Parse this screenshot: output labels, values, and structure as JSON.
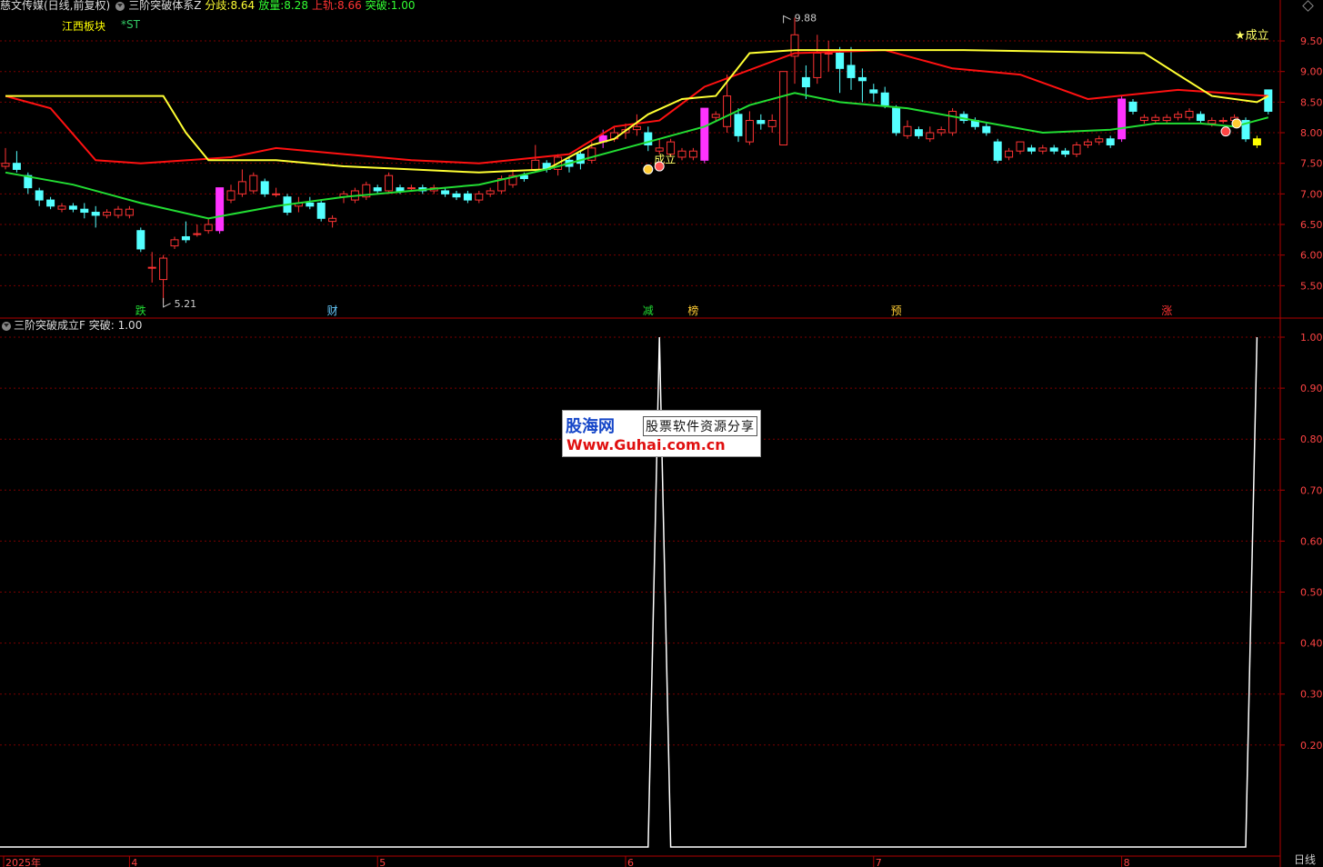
{
  "header": {
    "stock_title": "慈文传媒(日线,前复权)",
    "indicator_name": "三阶突破体系Z",
    "items": [
      {
        "label": "分歧:",
        "value": "8.64",
        "color": "#ffff33"
      },
      {
        "label": "放量:",
        "value": "8.28",
        "color": "#33ff33"
      },
      {
        "label": "上轨:",
        "value": "8.66",
        "color": "#ff3333"
      },
      {
        "label": "突破:",
        "value": "1.00",
        "color": "#33ff33"
      }
    ]
  },
  "sector": "江西板块",
  "st_flag": "*ST",
  "sub_header": {
    "title": "三阶突破成立F",
    "label": "突破:",
    "value": "1.00"
  },
  "period": "日线",
  "watermark": {
    "logo": "股海网",
    "tagline": "股票软件资源分享",
    "url": "Www.Guhai.com.cn"
  },
  "colors": {
    "up": "#ff3333",
    "down": "#54ffff",
    "signal_bar": "#ff33ff",
    "yellow_bar": "#ffff00",
    "upper_line": "#ff1111",
    "yellow_line": "#ffff33",
    "green_line": "#22dd33",
    "grid": "#7a0000",
    "axis": "#b00000",
    "sub_line": "#ffffff"
  },
  "chart_data": [
    {
      "type": "candlestick",
      "title": "三阶突破体系Z",
      "ylim": [
        5.0,
        10.05
      ],
      "y_ticks": [
        "9.50",
        "9.00",
        "8.50",
        "8.00",
        "7.50",
        "7.00",
        "6.50",
        "6.00",
        "5.50"
      ],
      "annotations": {
        "high": "9.88",
        "low": "5.21",
        "signal_label": "成立",
        "star_label": "★成立"
      },
      "bottom_marks": [
        {
          "i": 12,
          "text": "跌",
          "color": "#22dd33"
        },
        {
          "i": 29,
          "text": "财",
          "color": "#66ccff"
        },
        {
          "i": 57,
          "text": "减",
          "color": "#22dd33"
        },
        {
          "i": 61,
          "text": "榜",
          "color": "#ffcc33"
        },
        {
          "i": 79,
          "text": "预",
          "color": "#ffcc33"
        },
        {
          "i": 103,
          "text": "涨",
          "color": "#ff3333"
        }
      ],
      "candles": [
        [
          7.45,
          7.5,
          7.75,
          7.4
        ],
        [
          7.5,
          7.4,
          7.7,
          7.35
        ],
        [
          7.3,
          7.1,
          7.35,
          7.0
        ],
        [
          7.05,
          6.9,
          7.1,
          6.8
        ],
        [
          6.9,
          6.8,
          6.95,
          6.75
        ],
        [
          6.75,
          6.8,
          6.85,
          6.7
        ],
        [
          6.8,
          6.75,
          6.85,
          6.7
        ],
        [
          6.75,
          6.7,
          6.85,
          6.6
        ],
        [
          6.7,
          6.65,
          6.8,
          6.45
        ],
        [
          6.65,
          6.7,
          6.75,
          6.6
        ],
        [
          6.65,
          6.75,
          6.8,
          6.6
        ],
        [
          6.65,
          6.75,
          6.8,
          6.6
        ],
        [
          6.4,
          6.1,
          6.45,
          6.05
        ],
        [
          5.8,
          5.8,
          6.05,
          5.55
        ],
        [
          5.6,
          5.95,
          6.0,
          5.21
        ],
        [
          6.15,
          6.25,
          6.3,
          6.1
        ],
        [
          6.3,
          6.25,
          6.55,
          6.2
        ],
        [
          6.35,
          6.35,
          6.5,
          6.3
        ],
        [
          6.4,
          6.5,
          6.6,
          6.35
        ],
        [
          6.4,
          7.1,
          7.1,
          6.35
        ],
        [
          6.9,
          7.05,
          7.15,
          6.85
        ],
        [
          7.0,
          7.2,
          7.4,
          6.95
        ],
        [
          7.05,
          7.3,
          7.35,
          7.0
        ],
        [
          7.2,
          7.0,
          7.25,
          6.95
        ],
        [
          7.0,
          7.0,
          7.1,
          6.95
        ],
        [
          6.95,
          6.7,
          7.0,
          6.65
        ],
        [
          6.8,
          6.85,
          6.95,
          6.7
        ],
        [
          6.85,
          6.8,
          6.95,
          6.75
        ],
        [
          6.85,
          6.6,
          6.9,
          6.55
        ],
        [
          6.55,
          6.6,
          6.65,
          6.45
        ],
        [
          6.95,
          7.0,
          7.05,
          6.85
        ],
        [
          6.9,
          7.05,
          7.1,
          6.85
        ],
        [
          6.95,
          7.15,
          7.2,
          6.9
        ],
        [
          7.1,
          7.05,
          7.15,
          7.0
        ],
        [
          7.05,
          7.3,
          7.35,
          7.0
        ],
        [
          7.1,
          7.05,
          7.15,
          7.0
        ],
        [
          7.1,
          7.1,
          7.15,
          7.05
        ],
        [
          7.1,
          7.05,
          7.15,
          7.0
        ],
        [
          7.05,
          7.1,
          7.15,
          7.0
        ],
        [
          7.05,
          7.0,
          7.1,
          6.95
        ],
        [
          7.0,
          6.95,
          7.05,
          6.9
        ],
        [
          7.0,
          6.9,
          7.05,
          6.85
        ],
        [
          6.9,
          7.0,
          7.05,
          6.85
        ],
        [
          7.0,
          7.05,
          7.1,
          6.95
        ],
        [
          7.05,
          7.25,
          7.3,
          7.0
        ],
        [
          7.15,
          7.3,
          7.4,
          7.1
        ],
        [
          7.3,
          7.25,
          7.35,
          7.2
        ],
        [
          7.4,
          7.55,
          7.8,
          7.35
        ],
        [
          7.5,
          7.4,
          7.55,
          7.35
        ],
        [
          7.4,
          7.6,
          7.65,
          7.3
        ],
        [
          7.55,
          7.45,
          7.6,
          7.35
        ],
        [
          7.65,
          7.5,
          7.7,
          7.4
        ],
        [
          7.55,
          7.75,
          7.85,
          7.5
        ],
        [
          7.85,
          7.95,
          8.05,
          7.75
        ],
        [
          7.9,
          8.0,
          8.1,
          7.85
        ],
        [
          8.0,
          8.05,
          8.15,
          7.9
        ],
        [
          8.05,
          8.1,
          8.3,
          7.95
        ],
        [
          8.0,
          7.8,
          8.1,
          7.7
        ],
        [
          7.7,
          7.75,
          7.9,
          7.65
        ],
        [
          7.65,
          7.85,
          7.9,
          7.6
        ],
        [
          7.6,
          7.7,
          7.75,
          7.55
        ],
        [
          7.6,
          7.7,
          7.75,
          7.55
        ],
        [
          7.55,
          8.4,
          8.4,
          7.5
        ],
        [
          8.25,
          8.3,
          8.35,
          8.2
        ],
        [
          8.1,
          8.6,
          8.95,
          8.0
        ],
        [
          8.3,
          7.95,
          8.4,
          7.85
        ],
        [
          7.85,
          8.2,
          8.35,
          7.8
        ],
        [
          8.2,
          8.15,
          8.3,
          8.05
        ],
        [
          8.1,
          8.2,
          8.3,
          8.0
        ],
        [
          7.8,
          9.0,
          9.0,
          7.8
        ],
        [
          9.25,
          9.6,
          9.88,
          8.8
        ],
        [
          8.9,
          8.75,
          9.1,
          8.55
        ],
        [
          8.9,
          9.3,
          9.6,
          8.8
        ],
        [
          9.3,
          9.3,
          9.5,
          9.0
        ],
        [
          9.3,
          9.05,
          9.4,
          8.65
        ],
        [
          9.1,
          8.9,
          9.4,
          8.7
        ],
        [
          8.9,
          8.85,
          9.05,
          8.5
        ],
        [
          8.7,
          8.65,
          8.8,
          8.5
        ],
        [
          8.65,
          8.45,
          8.75,
          8.4
        ],
        [
          8.4,
          8.0,
          8.45,
          7.95
        ],
        [
          7.95,
          8.1,
          8.2,
          7.9
        ],
        [
          8.05,
          7.95,
          8.1,
          7.9
        ],
        [
          7.9,
          8.0,
          8.1,
          7.85
        ],
        [
          8.0,
          8.05,
          8.1,
          7.95
        ],
        [
          8.0,
          8.35,
          8.4,
          7.95
        ],
        [
          8.3,
          8.2,
          8.35,
          8.15
        ],
        [
          8.2,
          8.1,
          8.25,
          8.05
        ],
        [
          8.1,
          8.0,
          8.15,
          7.95
        ],
        [
          7.85,
          7.55,
          7.9,
          7.5
        ],
        [
          7.6,
          7.7,
          7.75,
          7.55
        ],
        [
          7.7,
          7.85,
          7.85,
          7.65
        ],
        [
          7.75,
          7.7,
          7.8,
          7.65
        ],
        [
          7.7,
          7.75,
          7.8,
          7.65
        ],
        [
          7.75,
          7.7,
          7.8,
          7.65
        ],
        [
          7.7,
          7.65,
          7.75,
          7.6
        ],
        [
          7.65,
          7.8,
          7.85,
          7.6
        ],
        [
          7.8,
          7.85,
          7.9,
          7.75
        ],
        [
          7.85,
          7.9,
          7.95,
          7.8
        ],
        [
          7.9,
          7.8,
          7.95,
          7.75
        ],
        [
          7.9,
          8.55,
          8.6,
          7.85
        ],
        [
          8.5,
          8.35,
          8.55,
          8.3
        ],
        [
          8.2,
          8.25,
          8.3,
          8.15
        ],
        [
          8.2,
          8.25,
          8.3,
          8.15
        ],
        [
          8.2,
          8.25,
          8.3,
          8.15
        ],
        [
          8.25,
          8.3,
          8.35,
          8.2
        ],
        [
          8.25,
          8.35,
          8.4,
          8.2
        ],
        [
          8.3,
          8.2,
          8.35,
          8.15
        ],
        [
          8.15,
          8.2,
          8.25,
          8.1
        ],
        [
          8.2,
          8.2,
          8.25,
          8.15
        ],
        [
          8.2,
          8.25,
          8.3,
          8.15
        ],
        [
          8.2,
          7.9,
          8.25,
          7.85
        ],
        [
          7.8,
          7.9,
          7.95,
          7.75
        ],
        [
          8.7,
          8.35,
          8.7,
          8.3
        ]
      ],
      "signal_bars": [
        19,
        53,
        62,
        99
      ],
      "yellow_bar": 111,
      "series": [
        {
          "name": "上轨",
          "color": "red",
          "values": [
            [
              0,
              8.6
            ],
            [
              4,
              8.4
            ],
            [
              8,
              7.55
            ],
            [
              12,
              7.5
            ],
            [
              20,
              7.6
            ],
            [
              24,
              7.75
            ],
            [
              30,
              7.65
            ],
            [
              36,
              7.55
            ],
            [
              42,
              7.5
            ],
            [
              50,
              7.65
            ],
            [
              54,
              8.1
            ],
            [
              58,
              8.2
            ],
            [
              62,
              8.75
            ],
            [
              70,
              9.3
            ],
            [
              78,
              9.35
            ],
            [
              84,
              9.05
            ],
            [
              90,
              8.95
            ],
            [
              96,
              8.55
            ],
            [
              104,
              8.7
            ],
            [
              112,
              8.6
            ]
          ]
        },
        {
          "name": "分歧",
          "color": "yellow",
          "values": [
            [
              0,
              8.6
            ],
            [
              10,
              8.6
            ],
            [
              14,
              8.6
            ],
            [
              16,
              8.0
            ],
            [
              18,
              7.55
            ],
            [
              24,
              7.55
            ],
            [
              30,
              7.45
            ],
            [
              36,
              7.4
            ],
            [
              42,
              7.35
            ],
            [
              48,
              7.4
            ],
            [
              52,
              7.8
            ],
            [
              54,
              7.9
            ],
            [
              57,
              8.3
            ],
            [
              60,
              8.55
            ],
            [
              63,
              8.6
            ],
            [
              66,
              9.3
            ],
            [
              70,
              9.35
            ],
            [
              85,
              9.35
            ],
            [
              101,
              9.3
            ],
            [
              104,
              8.95
            ],
            [
              107,
              8.6
            ],
            [
              111,
              8.5
            ],
            [
              112,
              8.6
            ]
          ]
        },
        {
          "name": "放量",
          "color": "green",
          "values": [
            [
              0,
              7.35
            ],
            [
              6,
              7.15
            ],
            [
              12,
              6.85
            ],
            [
              18,
              6.6
            ],
            [
              24,
              6.8
            ],
            [
              30,
              6.95
            ],
            [
              36,
              7.05
            ],
            [
              42,
              7.15
            ],
            [
              48,
              7.4
            ],
            [
              54,
              7.7
            ],
            [
              58,
              7.9
            ],
            [
              62,
              8.1
            ],
            [
              66,
              8.45
            ],
            [
              70,
              8.65
            ],
            [
              74,
              8.5
            ],
            [
              80,
              8.4
            ],
            [
              86,
              8.2
            ],
            [
              92,
              8.0
            ],
            [
              98,
              8.05
            ],
            [
              102,
              8.15
            ],
            [
              106,
              8.15
            ],
            [
              109,
              8.1
            ],
            [
              112,
              8.25
            ]
          ]
        }
      ]
    },
    {
      "type": "line",
      "title": "三阶突破成立F",
      "ylim": [
        0.0,
        1.0
      ],
      "y_ticks": [
        "1.00",
        "0.90",
        "0.80",
        "0.70",
        "0.60",
        "0.50",
        "0.40",
        "0.30",
        "0.20"
      ],
      "x_ticks": [
        {
          "i": 0,
          "label": "2025年"
        },
        {
          "i": 11,
          "label": "4"
        },
        {
          "i": 33,
          "label": "5"
        },
        {
          "i": 55,
          "label": "6"
        },
        {
          "i": 77,
          "label": "7"
        },
        {
          "i": 99,
          "label": "8"
        }
      ],
      "series": [
        {
          "name": "突破",
          "color": "white",
          "values": [
            [
              0,
              0
            ],
            [
              57,
              0
            ],
            [
              58,
              1
            ],
            [
              59,
              0
            ],
            [
              110,
              0
            ],
            [
              111,
              1
            ]
          ]
        }
      ]
    }
  ]
}
